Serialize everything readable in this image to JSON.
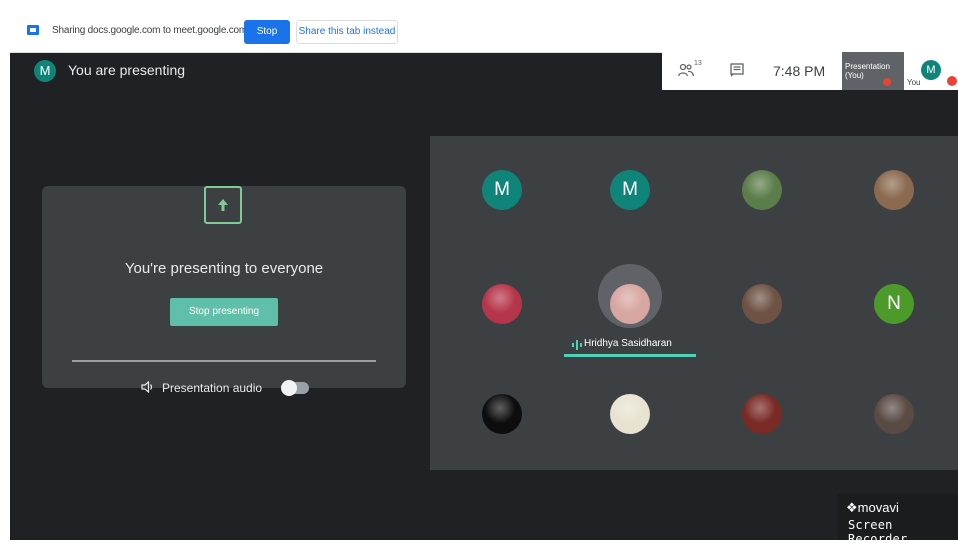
{
  "share_bar": {
    "text": "Sharing docs.google.com to meet.google.com",
    "stop_label": "Stop",
    "share_tab_label": "Share this tab instead"
  },
  "header": {
    "avatar_letter": "M",
    "status": "You are presenting"
  },
  "topbar": {
    "people_count": "13",
    "time": "7:48 PM",
    "presentation_thumb_label": "Presentation (You)",
    "you_label": "You",
    "avatar_letter": "M"
  },
  "present_card": {
    "title": "You're presenting to everyone",
    "stop_button": "Stop presenting",
    "audio_label": "Presentation audio"
  },
  "participants": [
    {
      "type": "letter",
      "letter": "M",
      "color": "#0f857a"
    },
    {
      "type": "letter",
      "letter": "M",
      "color": "#0f857a"
    },
    {
      "type": "photo",
      "color": "#5b7d4a"
    },
    {
      "type": "photo",
      "color": "#8b6a4f"
    },
    {
      "type": "photo",
      "color": "#b5364a"
    },
    {
      "type": "speaker",
      "color": "#d7a6a0",
      "name": "Hridhya Sasidharan"
    },
    {
      "type": "photo",
      "color": "#6e5345"
    },
    {
      "type": "letter",
      "letter": "N",
      "color": "#4c9a2a"
    },
    {
      "type": "photo",
      "color": "#0d0d0d"
    },
    {
      "type": "photo",
      "color": "#e8e3d0"
    },
    {
      "type": "photo",
      "color": "#7a2a25"
    },
    {
      "type": "photo",
      "color": "#5a4a44"
    }
  ],
  "watermark": {
    "logo": "movavi",
    "subtitle": "Screen Recorder"
  },
  "colors": {
    "background": "#202124",
    "panel": "#3c4043",
    "accent": "#1a73e8",
    "teal": "#0f857a"
  }
}
